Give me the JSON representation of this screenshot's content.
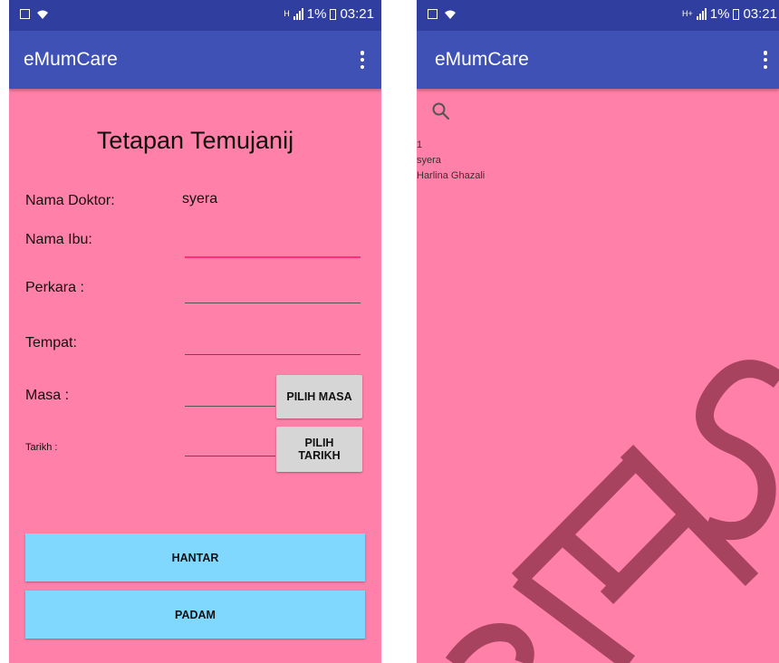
{
  "left_screen": {
    "status": {
      "time": "03:21",
      "battery": "1%",
      "net": "H"
    },
    "appbar": {
      "title": "eMumCare"
    },
    "form": {
      "title": "Tetapan Temujanij",
      "doctor_label": "Nama Doktor:",
      "doctor_value": "syera",
      "mother_label": "Nama Ibu:",
      "case_label": "Perkara :",
      "place_label": "Tempat:",
      "time_label": "Masa :",
      "date_label": "Tarikh :",
      "pick_time_button": "PILIH MASA",
      "pick_date_button": "PILIH\nTARIKH",
      "submit_button": "HANTAR",
      "delete_button": "PADAM"
    }
  },
  "right_screen": {
    "status": {
      "time": "03:21",
      "battery": "1%",
      "net": "H+"
    },
    "appbar": {
      "title": "eMumCare"
    },
    "list": {
      "line1": "1",
      "line2": "syera",
      "line3": "Harlina Ghazali"
    },
    "watermark_text": "SOFTSM"
  },
  "colors": {
    "status_bar": "#303f9f",
    "app_bar": "#3f51b5",
    "background": "#ff80a9",
    "button_blue": "#80d8ff",
    "button_grey": "#d6d6d6",
    "input_focus": "#ff2d7a",
    "watermark": "#a8435f"
  },
  "icons": [
    "wifi-icon",
    "signal-icon",
    "battery-icon",
    "overflow-menu-icon",
    "search-icon"
  ]
}
